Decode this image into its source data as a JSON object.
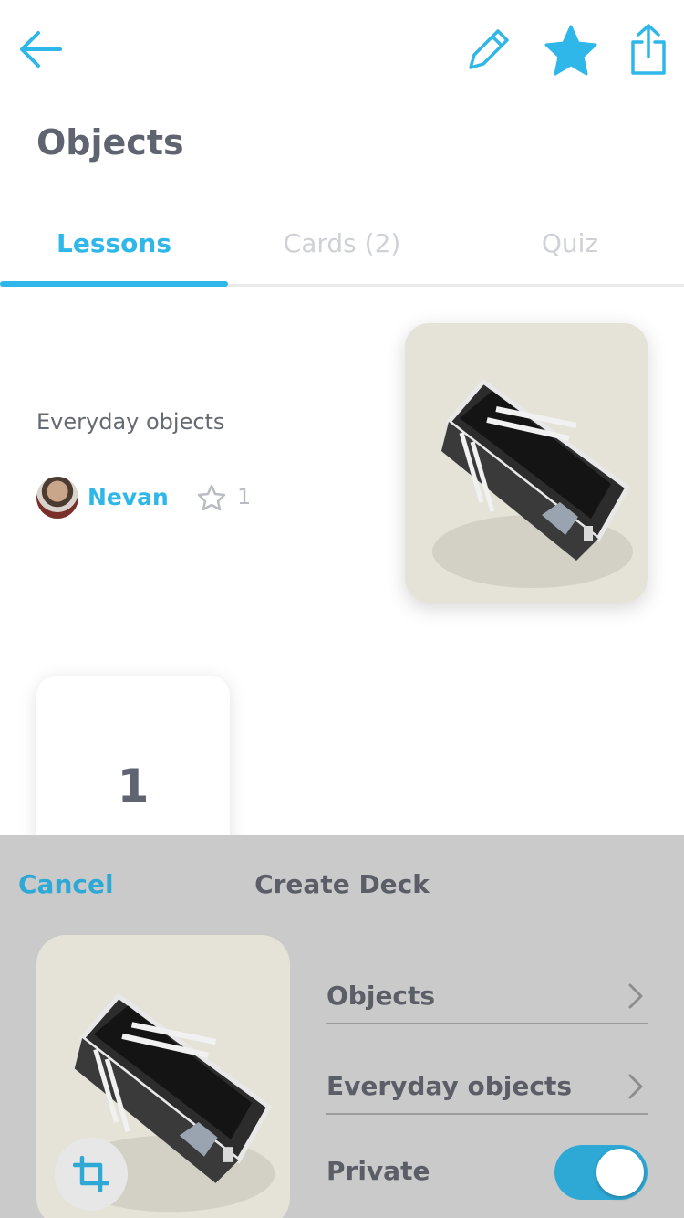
{
  "header": {
    "title": "Objects",
    "icons": {
      "back": "back-arrow-icon",
      "edit": "pencil-icon",
      "favorite": "star-icon",
      "share": "share-icon"
    }
  },
  "tabs": [
    {
      "label": "Lessons",
      "active": true
    },
    {
      "label": "Cards (2)",
      "active": false
    },
    {
      "label": "Quiz",
      "active": false
    }
  ],
  "lesson": {
    "description": "Everyday objects",
    "author": "Nevan",
    "star_count": "1",
    "image": "pencil-case-photo"
  },
  "deck_card": {
    "number": "1"
  },
  "sheet": {
    "cancel_label": "Cancel",
    "title": "Create Deck",
    "fields": [
      {
        "label": "Objects"
      },
      {
        "label": "Everyday objects"
      }
    ],
    "private_label": "Private",
    "private_enabled": true,
    "image": "pencil-case-photo",
    "crop_icon": "crop-icon"
  },
  "colors": {
    "accent": "#2eb7e8",
    "text": "#5f6470",
    "sheet_background": "#cacaca"
  }
}
